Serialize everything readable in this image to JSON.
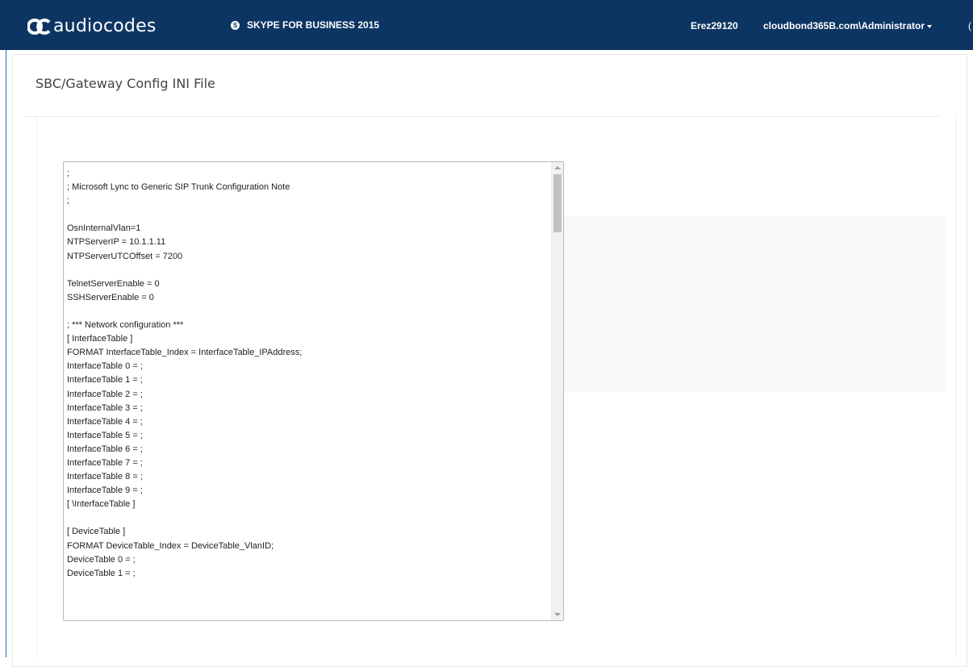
{
  "header": {
    "logo_text": "audiocodes",
    "product_label": "SKYPE FOR BUSINESS 2015",
    "product_icon": "skype-icon",
    "host": "Erez29120",
    "user": "cloudbond365B.com\\Administrator",
    "edge_text": "("
  },
  "panel": {
    "title": "SBC/Gateway Config INI File"
  },
  "ini_file": {
    "content": ";\n; Microsoft Lync to Generic SIP Trunk Configuration Note\n;\n\nOsnInternalVlan=1\nNTPServerIP = 10.1.1.11\nNTPServerUTCOffset = 7200\n\nTelnetServerEnable = 0\nSSHServerEnable = 0\n\n; *** Network configuration ***\n[ InterfaceTable ]\nFORMAT InterfaceTable_Index = InterfaceTable_IPAddress;\nInterfaceTable 0 = ;\nInterfaceTable 1 = ;\nInterfaceTable 2 = ;\nInterfaceTable 3 = ;\nInterfaceTable 4 = ;\nInterfaceTable 5 = ;\nInterfaceTable 6 = ;\nInterfaceTable 7 = ;\nInterfaceTable 8 = ;\nInterfaceTable 9 = ;\n[ \\InterfaceTable ]\n\n[ DeviceTable ]\nFORMAT DeviceTable_Index = DeviceTable_VlanID;\nDeviceTable 0 = ;\nDeviceTable 1 = ;"
  },
  "colors": {
    "navbar": "#0d3563",
    "accent": "#1b6db5"
  }
}
